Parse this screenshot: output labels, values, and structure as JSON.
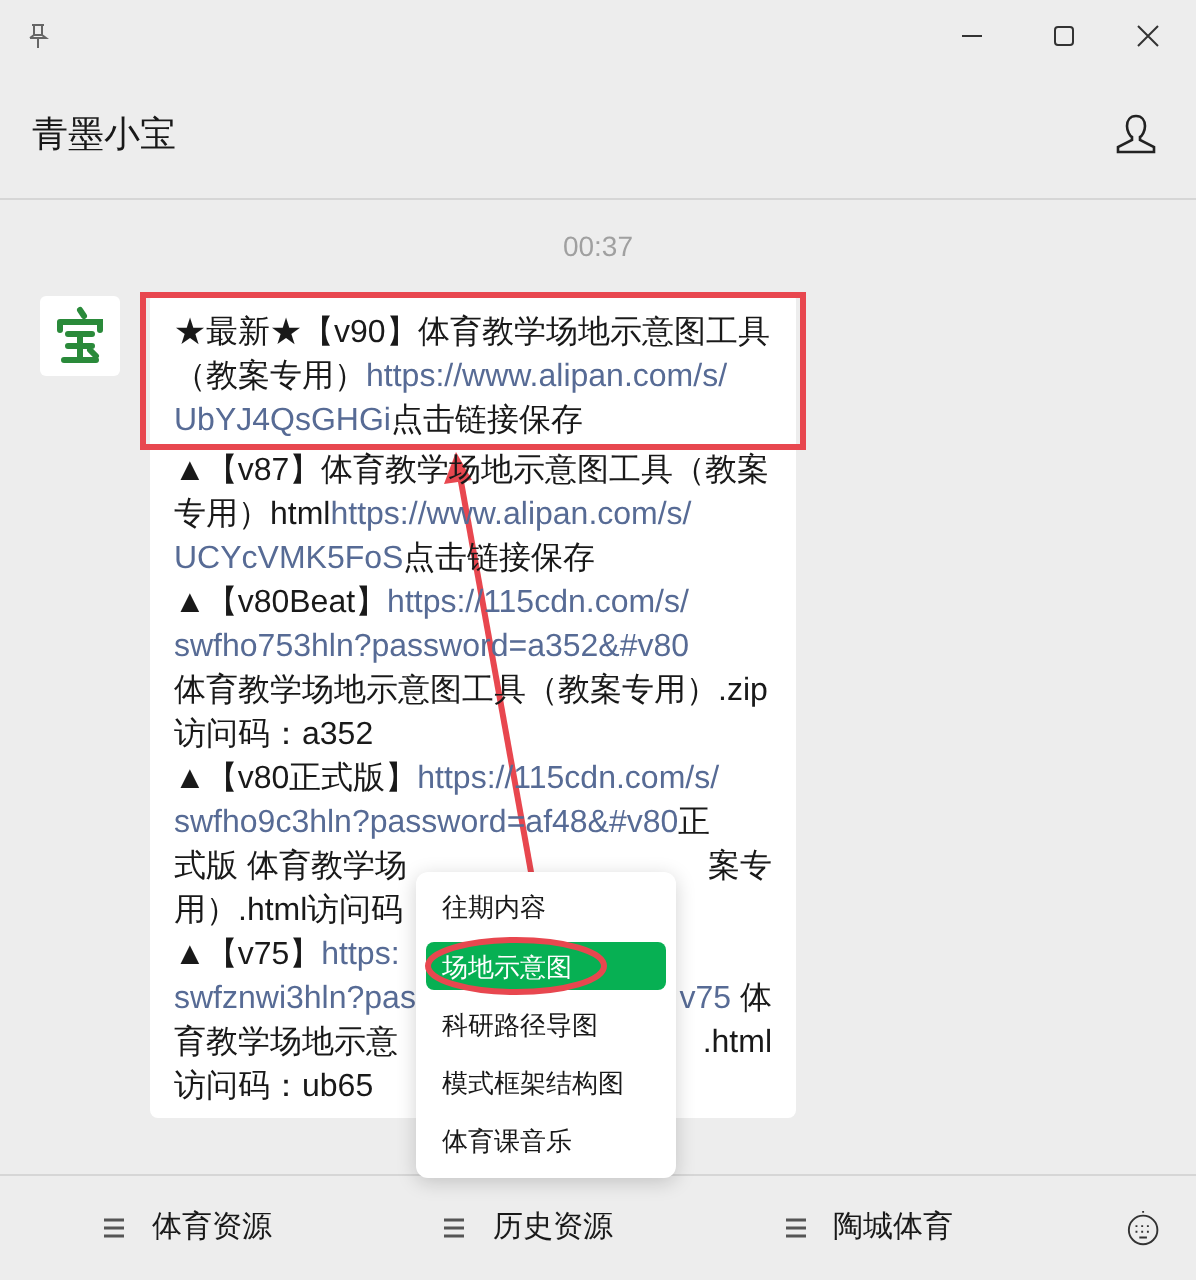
{
  "header": {
    "title": "青墨小宝"
  },
  "time": "00:37",
  "message": {
    "paragraphs": [
      {
        "boxed": true,
        "lines": [
          {
            "left": [
              {
                "kind": "text",
                "text": "★最新★【v90】体育教学场地示意图工具"
              }
            ]
          },
          {
            "left": [
              {
                "kind": "text",
                "text": "（教案专用）"
              },
              {
                "kind": "link",
                "text": "https://www.alipan.com/s/"
              }
            ]
          },
          {
            "left": [
              {
                "kind": "link",
                "text": "UbYJ4QsGHGi"
              },
              {
                "kind": "text",
                "text": "点击链接保存"
              }
            ]
          }
        ]
      },
      {
        "boxed": false,
        "lines": [
          {
            "left": [
              {
                "kind": "text",
                "text": "▲【v87】体育教学场地示意图工具（教案"
              }
            ]
          },
          {
            "left": [
              {
                "kind": "text",
                "text": "专用）html"
              },
              {
                "kind": "link",
                "text": "https://www.alipan.com/s/"
              }
            ]
          },
          {
            "left": [
              {
                "kind": "link",
                "text": "UCYcVMK5FoS"
              },
              {
                "kind": "text",
                "text": "点击链接保存"
              }
            ]
          },
          {
            "left": [
              {
                "kind": "text",
                "text": "▲【v80Beat】"
              },
              {
                "kind": "link",
                "text": "https://115cdn.com/s/"
              }
            ]
          },
          {
            "left": [
              {
                "kind": "link",
                "text": "swfho753hln?password=a352&#v80"
              }
            ]
          },
          {
            "left": [
              {
                "kind": "text",
                "text": "体育教学场地示意图工具（教案专用）.zip"
              }
            ]
          },
          {
            "left": [
              {
                "kind": "text",
                "text": "访问码：a352"
              }
            ]
          },
          {
            "left": [
              {
                "kind": "text",
                "text": "▲【v80正式版】"
              },
              {
                "kind": "link",
                "text": "https://115cdn.com/s/"
              }
            ]
          },
          {
            "left": [
              {
                "kind": "link",
                "text": "swfho9c3hln?password=af48&#v80"
              },
              {
                "kind": "text",
                "text": "正"
              }
            ]
          },
          {
            "left": [
              {
                "kind": "text",
                "text": "式版 体育教学场"
              }
            ],
            "right": [
              {
                "kind": "text",
                "text": "案专"
              }
            ]
          },
          {
            "left": [
              {
                "kind": "text",
                "text": "用）.html访问码"
              }
            ]
          },
          {
            "left": [
              {
                "kind": "text",
                "text": "▲【v75】"
              },
              {
                "kind": "link",
                "text": "https:"
              }
            ]
          },
          {
            "left": [
              {
                "kind": "link",
                "text": "swfznwi3hln?pas"
              }
            ],
            "right": [
              {
                "kind": "link",
                "text": "v75"
              },
              {
                "kind": "text",
                "text": " 体"
              }
            ]
          },
          {
            "left": [
              {
                "kind": "text",
                "text": "育教学场地示意"
              }
            ],
            "right": [
              {
                "kind": "text",
                "text": ".html"
              }
            ]
          },
          {
            "left": [
              {
                "kind": "text",
                "text": "访问码：ub65"
              }
            ]
          }
        ]
      }
    ]
  },
  "menu": {
    "items": [
      {
        "label": "往期内容",
        "selected": false,
        "circled": false
      },
      {
        "label": "场地示意图",
        "selected": true,
        "circled": true
      },
      {
        "label": "科研路径导图",
        "selected": false,
        "circled": false
      },
      {
        "label": "模式框架结构图",
        "selected": false,
        "circled": false
      },
      {
        "label": "体育课音乐",
        "selected": false,
        "circled": false
      }
    ]
  },
  "bottom_bar": {
    "items": [
      "体育资源",
      "历史资源",
      "陶城体育"
    ]
  }
}
